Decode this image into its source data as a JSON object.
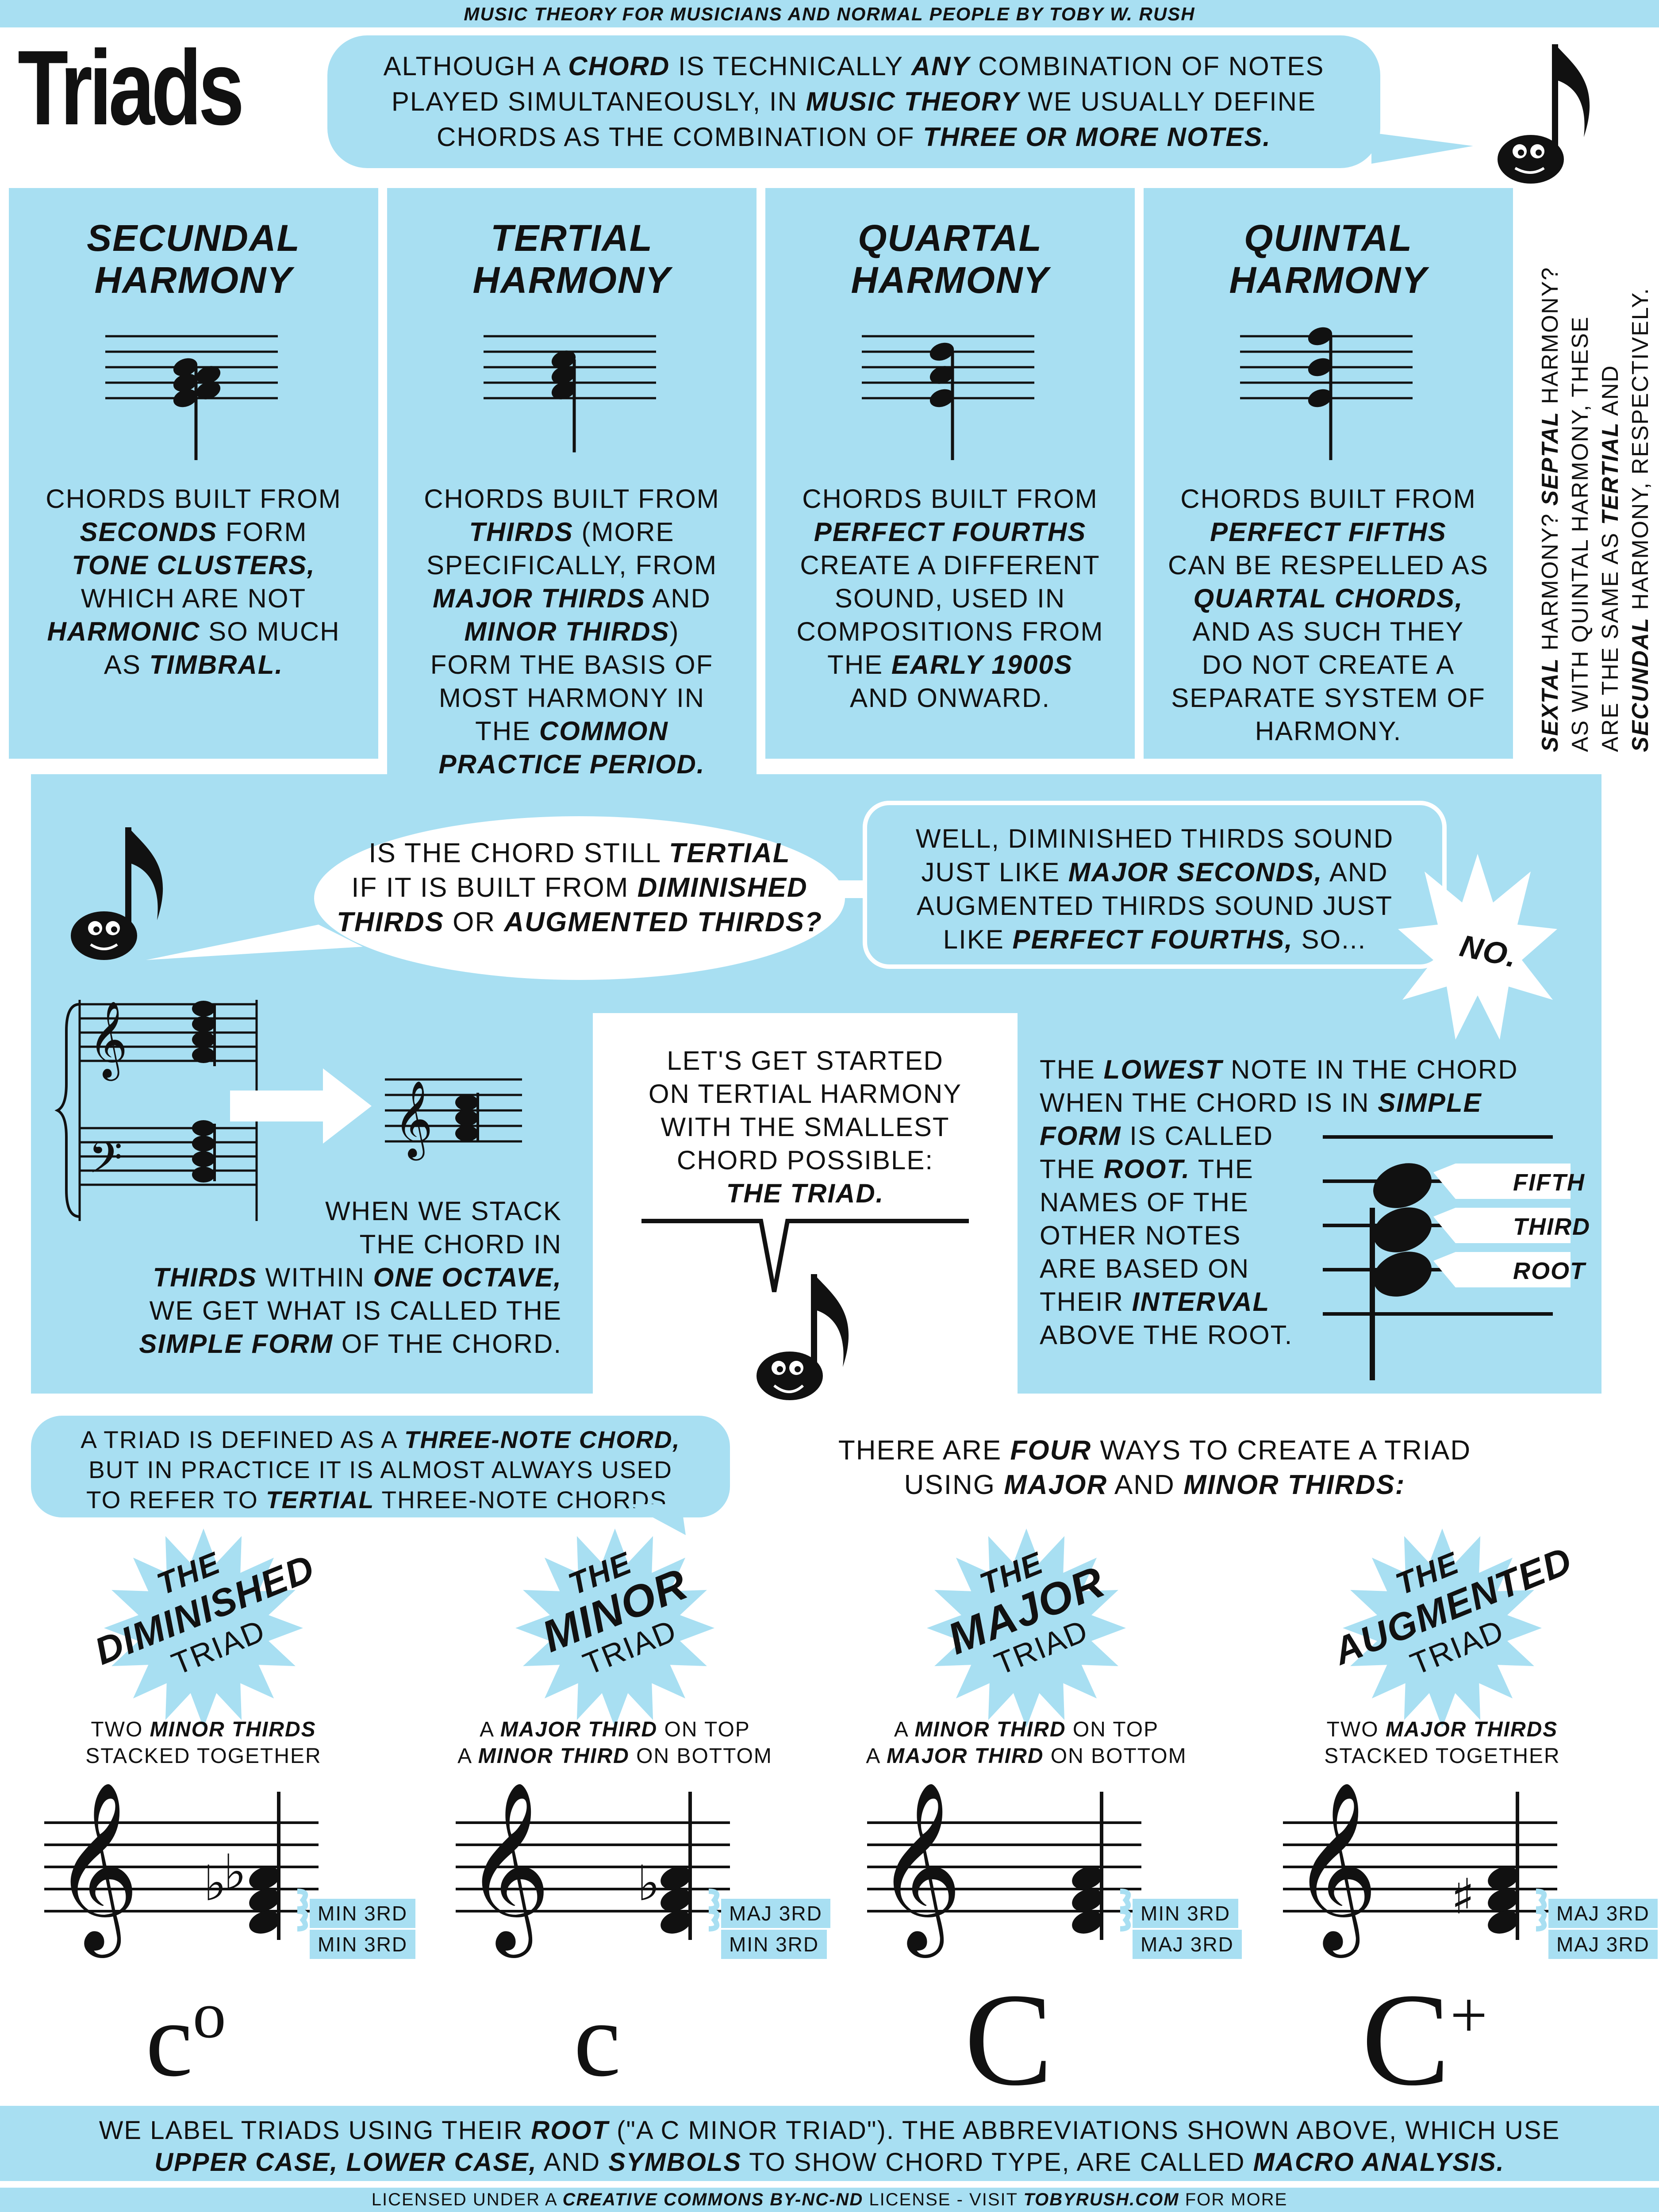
{
  "header": {
    "series": "MUSIC THEORY FOR MUSICIANS AND NORMAL PEOPLE BY TOBY W. RUSH",
    "title": "Triads"
  },
  "intro": {
    "l1a": "ALTHOUGH A ",
    "l1b": "CHORD",
    "l1c": " IS TECHNICALLY ",
    "l1d": "ANY",
    "l1e": " COMBINATION OF NOTES",
    "l2a": "PLAYED SIMULTANEOUSLY, IN ",
    "l2b": "MUSIC THEORY",
    "l2c": " WE USUALLY DEFINE",
    "l3a": "CHORDS AS THE COMBINATION OF ",
    "l3b": "THREE OR MORE NOTES."
  },
  "harmonies": [
    {
      "title1": "SECUNDAL",
      "title2": "HARMONY",
      "lines": [
        [
          "CHORDS BUILT FROM",
          ""
        ],
        [
          "",
          "SECONDS",
          " FORM"
        ],
        [
          "",
          "TONE CLUSTERS,"
        ],
        [
          "WHICH ARE NOT",
          ""
        ],
        [
          "",
          "HARMONIC",
          " SO MUCH"
        ],
        [
          "AS ",
          "TIMBRAL."
        ]
      ]
    },
    {
      "title1": "TERTIAL",
      "title2": "HARMONY",
      "lines": [
        [
          "CHORDS BUILT FROM",
          ""
        ],
        [
          "",
          "THIRDS",
          " (MORE"
        ],
        [
          "SPECIFICALLY, FROM",
          ""
        ],
        [
          "",
          "MAJOR THIRDS",
          " AND"
        ],
        [
          "",
          "MINOR THIRDS",
          ")"
        ],
        [
          "FORM THE BASIS OF",
          ""
        ],
        [
          "MOST HARMONY IN",
          ""
        ],
        [
          "THE ",
          "COMMON"
        ],
        [
          "",
          "PRACTICE PERIOD."
        ]
      ]
    },
    {
      "title1": "QUARTAL",
      "title2": "HARMONY",
      "lines": [
        [
          "CHORDS BUILT FROM",
          ""
        ],
        [
          "",
          "PERFECT FOURTHS"
        ],
        [
          "CREATE A DIFFERENT",
          ""
        ],
        [
          "SOUND, USED IN",
          ""
        ],
        [
          "COMPOSITIONS FROM",
          ""
        ],
        [
          "THE ",
          "EARLY 1900s"
        ],
        [
          "AND ONWARD.",
          ""
        ]
      ]
    },
    {
      "title1": "QUINTAL",
      "title2": "HARMONY",
      "lines": [
        [
          "CHORDS BUILT FROM",
          ""
        ],
        [
          "",
          "PERFECT FIFTHS"
        ],
        [
          "CAN BE RESPELLED AS",
          ""
        ],
        [
          "",
          "QUARTAL CHORDS,"
        ],
        [
          "AND AS SUCH THEY",
          ""
        ],
        [
          "DO NOT CREATE A",
          ""
        ],
        [
          "SEPARATE SYSTEM OF",
          ""
        ],
        [
          "HARMONY.",
          ""
        ]
      ]
    }
  ],
  "side_note": {
    "l1a": "SEXTAL",
    "l1b": " HARMONY? ",
    "l1c": "SEPTAL",
    "l1d": " HARMONY?",
    "l2": "AS WITH QUINTAL HARMONY, THESE",
    "l3a": "ARE THE SAME AS ",
    "l3b": "TERTIAL",
    "l3c": " AND",
    "l4a": "SECUNDAL",
    "l4b": " HARMONY, RESPECTIVELY."
  },
  "question": {
    "l1a": "IS THE CHORD STILL ",
    "l1b": "TERTIAL",
    "l2a": "IF IT IS BUILT FROM ",
    "l2b": "DIMINISHED",
    "l3a": "THIRDS",
    "l3b": " OR ",
    "l3c": "AUGMENTED THIRDS?"
  },
  "answer": {
    "l1": "WELL, DIMINISHED THIRDS SOUND",
    "l2a": "JUST LIKE ",
    "l2b": "MAJOR SECONDS,",
    "l2c": " AND",
    "l3": "AUGMENTED THIRDS SOUND JUST",
    "l4a": "LIKE ",
    "l4b": "PERFECT FOURTHS,",
    "l4c": " SO...",
    "no": "NO."
  },
  "simple_form": {
    "l1": "WHEN WE STACK",
    "l2": "THE CHORD IN",
    "l3a": "THIRDS",
    "l3b": " WITHIN ",
    "l3c": "ONE OCTAVE,",
    "l4": "WE GET WHAT IS CALLED THE",
    "l5a": "SIMPLE FORM",
    "l5b": " OF THE CHORD."
  },
  "get_started": {
    "l1": "LET'S GET STARTED",
    "l2": "ON TERTIAL HARMONY",
    "l3": "WITH THE SMALLEST",
    "l4": "CHORD POSSIBLE:",
    "l5": "THE TRIAD."
  },
  "root_text": {
    "l1a": "THE ",
    "l1b": "LOWEST",
    "l1c": " NOTE IN THE CHORD",
    "l2a": "WHEN THE CHORD IS IN ",
    "l2b": "SIMPLE",
    "l3a": "FORM",
    "l3b": " IS CALLED",
    "l4a": "THE ",
    "l4b": "ROOT.",
    "l4c": " THE",
    "l5": "NAMES OF THE",
    "l6": "OTHER NOTES",
    "l7": "ARE BASED ON",
    "l8a": "THEIR ",
    "l8b": "INTERVAL",
    "l9": "ABOVE THE ROOT.",
    "fifth": "FIFTH",
    "third": "THIRD",
    "root": "ROOT"
  },
  "triad_def": {
    "l1a": "A TRIAD IS DEFINED AS A ",
    "l1b": "THREE-NOTE CHORD,",
    "l2": "BUT IN PRACTICE IT IS ALMOST ALWAYS USED",
    "l3a": "TO REFER TO ",
    "l3b": "TERTIAL",
    "l3c": " THREE-NOTE CHORDS."
  },
  "four_ways": {
    "l1a": "THERE ARE ",
    "l1b": "FOUR",
    "l1c": " WAYS TO CREATE A TRIAD",
    "l2a": "USING ",
    "l2b": "MAJOR",
    "l2c": " AND ",
    "l2d": "MINOR THIRDS:"
  },
  "triads": [
    {
      "the": "THE",
      "name": "DIMINISHED",
      "triad": "TRIAD",
      "d1a": "TWO ",
      "d1b": "MINOR THIRDS",
      "d1c": "",
      "d2a": "STACKED TOGETHER",
      "d2b": "",
      "d2c": "",
      "top": "MIN 3RD",
      "bottom": "MIN 3RD",
      "symbol": "c",
      "sup": "o",
      "accidental": "flat2"
    },
    {
      "the": "THE",
      "name": "MINOR",
      "triad": "TRIAD",
      "d1a": "A ",
      "d1b": "MAJOR THIRD",
      "d1c": " ON TOP",
      "d2a": "A ",
      "d2b": "MINOR THIRD",
      "d2c": " ON BOTTOM",
      "top": "MAJ 3RD",
      "bottom": "MIN 3RD",
      "symbol": "c",
      "sup": "",
      "accidental": "flat1"
    },
    {
      "the": "THE",
      "name": "MAJOR",
      "triad": "TRIAD",
      "d1a": "A ",
      "d1b": "MINOR THIRD",
      "d1c": " ON TOP",
      "d2a": "A ",
      "d2b": "MAJOR THIRD",
      "d2c": " ON BOTTOM",
      "top": "MIN 3RD",
      "bottom": "MAJ 3RD",
      "symbol": "C",
      "sup": "",
      "accidental": "none"
    },
    {
      "the": "THE",
      "name": "AUGMENTED",
      "triad": "TRIAD",
      "d1a": "TWO ",
      "d1b": "MAJOR THIRDS",
      "d1c": "",
      "d2a": "STACKED TOGETHER",
      "d2b": "",
      "d2c": "",
      "top": "MAJ 3RD",
      "bottom": "MAJ 3RD",
      "symbol": "C",
      "sup": "+",
      "accidental": "sharp"
    }
  ],
  "footer": {
    "l1a": "WE LABEL TRIADS USING THEIR ",
    "l1b": "ROOT",
    "l1c": " (\"A C MINOR TRIAD\"). THE ABBREVIATIONS SHOWN ABOVE, WHICH USE",
    "l2a": "UPPER CASE, LOWER CASE,",
    "l2b": " AND ",
    "l2c": "SYMBOLS",
    "l2d": " TO SHOW CHORD TYPE, ARE CALLED ",
    "l2e": "MACRO ANALYSIS.",
    "lic_a": "LICENSED UNDER A ",
    "lic_b": "CREATIVE COMMONS BY-NC-ND",
    "lic_c": " LICENSE - VISIT ",
    "lic_d": "TOBYRUSH.COM",
    "lic_e": " FOR MORE"
  },
  "colors": {
    "accent": "#a8dff2",
    "ink": "#111111",
    "paper": "#ffffff"
  }
}
